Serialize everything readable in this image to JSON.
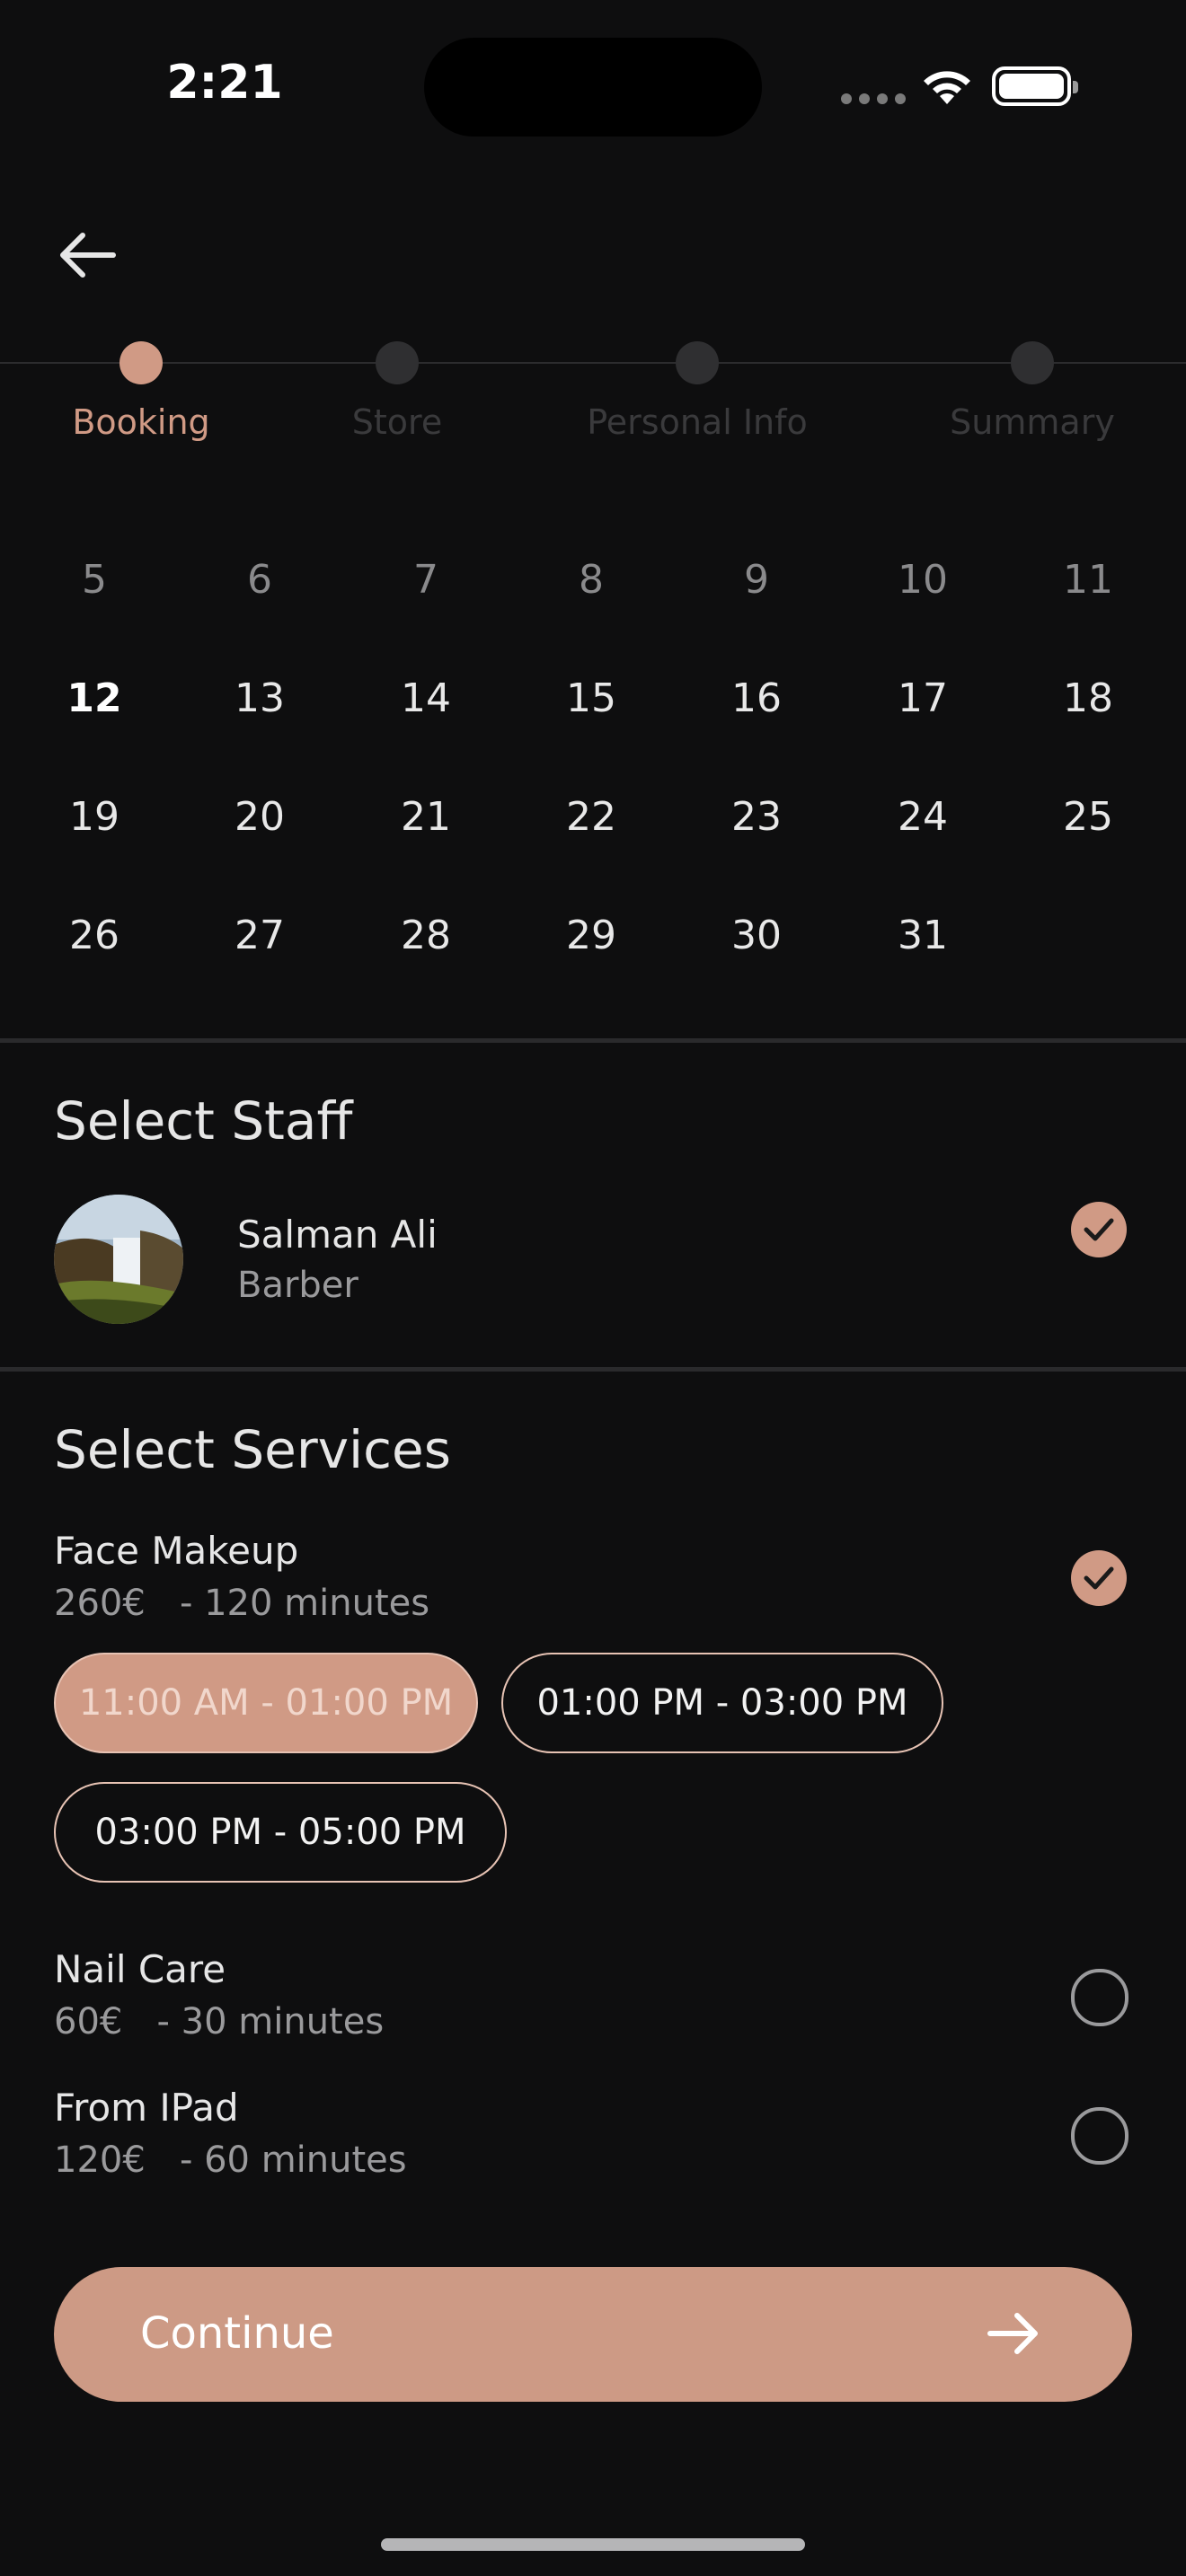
{
  "status_bar": {
    "time": "2:21"
  },
  "stepper": {
    "steps": [
      {
        "label": "Booking",
        "active": true
      },
      {
        "label": "Store",
        "active": false
      },
      {
        "label": "Personal Info",
        "active": false
      },
      {
        "label": "Summary",
        "active": false
      }
    ]
  },
  "calendar": {
    "rows": [
      [
        "5",
        "6",
        "7",
        "8",
        "9",
        "10",
        "11"
      ],
      [
        "12",
        "13",
        "14",
        "15",
        "16",
        "17",
        "18"
      ],
      [
        "19",
        "20",
        "21",
        "22",
        "23",
        "24",
        "25"
      ],
      [
        "26",
        "27",
        "28",
        "29",
        "30",
        "31",
        ""
      ]
    ],
    "today": "12"
  },
  "staff": {
    "title": "Select Staff",
    "name": "Salman Ali",
    "role": "Barber",
    "selected": true
  },
  "services": {
    "title": "Select Services",
    "items": [
      {
        "name": "Face Makeup",
        "price": "260€",
        "duration": "- 120 minutes",
        "selected": true
      },
      {
        "name": "Nail Care",
        "price": "60€",
        "duration": "- 30 minutes",
        "selected": false
      },
      {
        "name": "From IPad",
        "price": "120€",
        "duration": "- 60 minutes",
        "selected": false
      }
    ],
    "time_slots": [
      {
        "label": "11:00 AM - 01:00 PM",
        "selected": true
      },
      {
        "label": "01:00 PM - 03:00 PM",
        "selected": false
      },
      {
        "label": "03:00 PM - 05:00 PM",
        "selected": false
      }
    ]
  },
  "continue_label": "Continue",
  "colors": {
    "accent": "#d09a85",
    "background": "#0e0e0f"
  },
  "icons": [
    "back-arrow-icon",
    "wifi-icon",
    "battery-icon",
    "check-icon",
    "arrow-right-icon"
  ]
}
